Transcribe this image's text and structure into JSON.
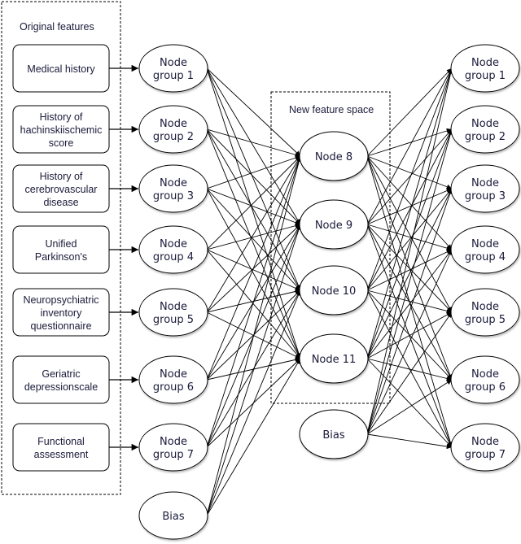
{
  "diagram": {
    "type": "neural-network-diagram",
    "original_features_title": "Original features",
    "new_feature_space_title": "New feature space",
    "features": [
      {
        "lines": [
          "Medical history"
        ]
      },
      {
        "lines": [
          "History of",
          "hachinskiischemic",
          "score"
        ]
      },
      {
        "lines": [
          "History of",
          "cerebrovascular",
          "disease"
        ]
      },
      {
        "lines": [
          "Unified",
          "Parkinson's"
        ]
      },
      {
        "lines": [
          "Neuropsychiatric",
          "inventory",
          "questionnaire"
        ]
      },
      {
        "lines": [
          "Geriatric",
          "depressionscale"
        ]
      },
      {
        "lines": [
          "Functional",
          "assessment"
        ]
      }
    ],
    "input_nodes": [
      {
        "lines": [
          "Node",
          "group 1"
        ]
      },
      {
        "lines": [
          "Node",
          "group 2"
        ]
      },
      {
        "lines": [
          "Node",
          "group 3"
        ]
      },
      {
        "lines": [
          "Node",
          "group 4"
        ]
      },
      {
        "lines": [
          "Node",
          "group 5"
        ]
      },
      {
        "lines": [
          "Node",
          "group 6"
        ]
      },
      {
        "lines": [
          "Node",
          "group 7"
        ]
      },
      {
        "lines": [
          "Bias"
        ],
        "bias": true
      }
    ],
    "hidden_nodes": [
      {
        "lines": [
          "Node 8"
        ]
      },
      {
        "lines": [
          "Node 9"
        ]
      },
      {
        "lines": [
          "Node 10"
        ]
      },
      {
        "lines": [
          "Node 11"
        ]
      },
      {
        "lines": [
          "Bias"
        ],
        "bias": true
      }
    ],
    "output_nodes": [
      {
        "lines": [
          "Node",
          "group 1"
        ]
      },
      {
        "lines": [
          "Node",
          "group 2"
        ]
      },
      {
        "lines": [
          "Node",
          "group 3"
        ]
      },
      {
        "lines": [
          "Node",
          "group 4"
        ]
      },
      {
        "lines": [
          "Node",
          "group 5"
        ]
      },
      {
        "lines": [
          "Node",
          "group 6"
        ]
      },
      {
        "lines": [
          "Node",
          "group 7"
        ]
      }
    ],
    "connectivity": "fully-connected",
    "colors": {
      "stroke": "#000000",
      "text": "#1a1a3a",
      "fill": "#ffffff"
    }
  }
}
